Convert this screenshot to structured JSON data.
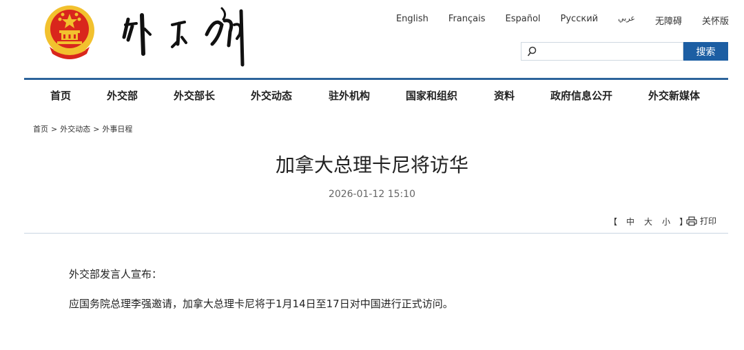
{
  "header": {
    "languages": [
      "English",
      "Français",
      "Español",
      "Русский",
      "عربي",
      "无障碍",
      "关怀版"
    ],
    "search": {
      "placeholder": "",
      "button_label": "搜索"
    }
  },
  "nav": {
    "items": [
      "首页",
      "外交部",
      "外交部长",
      "外交动态",
      "驻外机构",
      "国家和组织",
      "资料",
      "政府信息公开",
      "外交新媒体"
    ]
  },
  "breadcrumb": [
    "首页",
    "外交动态",
    "外事日程"
  ],
  "breadcrumb_sep": ">",
  "article": {
    "title": "加拿大总理卡尼将访华",
    "date": "2026-01-12 15:10",
    "font_controls": {
      "open": "【",
      "large": "中",
      "medium": "大",
      "small": "小",
      "close": "】"
    },
    "print_label": "打印",
    "paragraphs": [
      "外交部发言人宣布：",
      "应国务院总理李强邀请，加拿大总理卡尼将于1月14日至17日对中国进行正式访问。"
    ]
  },
  "colors": {
    "brand_blue": "#1c5ea3",
    "nav_line": "#2c639b",
    "emblem_red": "#d9261c",
    "emblem_gold": "#f2c12e"
  },
  "icons": {
    "emblem": "national-emblem-icon",
    "search": "search-icon",
    "print": "printer-icon"
  }
}
